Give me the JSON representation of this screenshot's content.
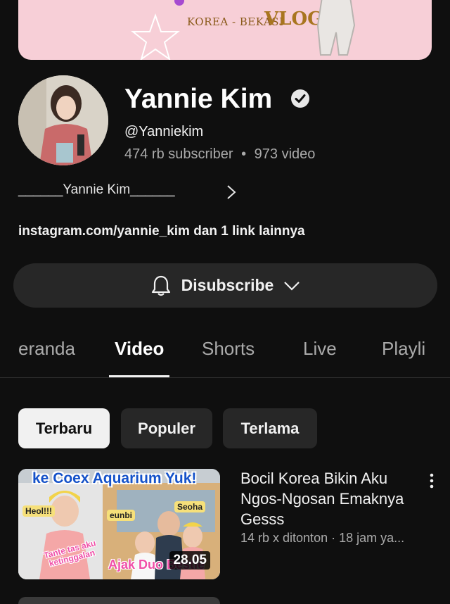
{
  "banner": {
    "subtitle": "KOREA - BEKASI",
    "title": "VLOG!"
  },
  "channel": {
    "name": "Yannie Kim",
    "handle": "@Yanniekim",
    "subscribers": "474 rb subscriber",
    "separator": "•",
    "videos": "973 video",
    "description": "______Yannie Kim______",
    "links": "instagram.com/yannie_kim dan 1 link lainnya"
  },
  "subscribe_button": {
    "label": "Disubscribe"
  },
  "tabs": [
    {
      "label": "eranda"
    },
    {
      "label": "Video"
    },
    {
      "label": "Shorts"
    },
    {
      "label": "Live"
    },
    {
      "label": "Playli"
    }
  ],
  "chips": [
    {
      "label": "Terbaru"
    },
    {
      "label": "Populer"
    },
    {
      "label": "Terlama"
    }
  ],
  "videos": [
    {
      "thumbnail_title": "ke Coex Aquarium Yuk!",
      "thumbnail_tags": [
        "Heol!!!",
        "eunbi",
        "Seoha"
      ],
      "thumbnail_side": "Tante tas aku ketinggalan",
      "thumbnail_caption": "Ajak Duo Bestie",
      "duration": "28.05",
      "title": "Bocil Korea Bikin Aku Ngos-Ngosan Emaknya  Gesss",
      "meta": "14 rb x ditonton · 18 jam ya..."
    }
  ],
  "colors": {
    "background": "#0f0f0f",
    "surface": "#272727",
    "text_primary": "#f1f1f1",
    "text_secondary": "#aaaaaa",
    "banner_pink": "#f7cfd7"
  }
}
